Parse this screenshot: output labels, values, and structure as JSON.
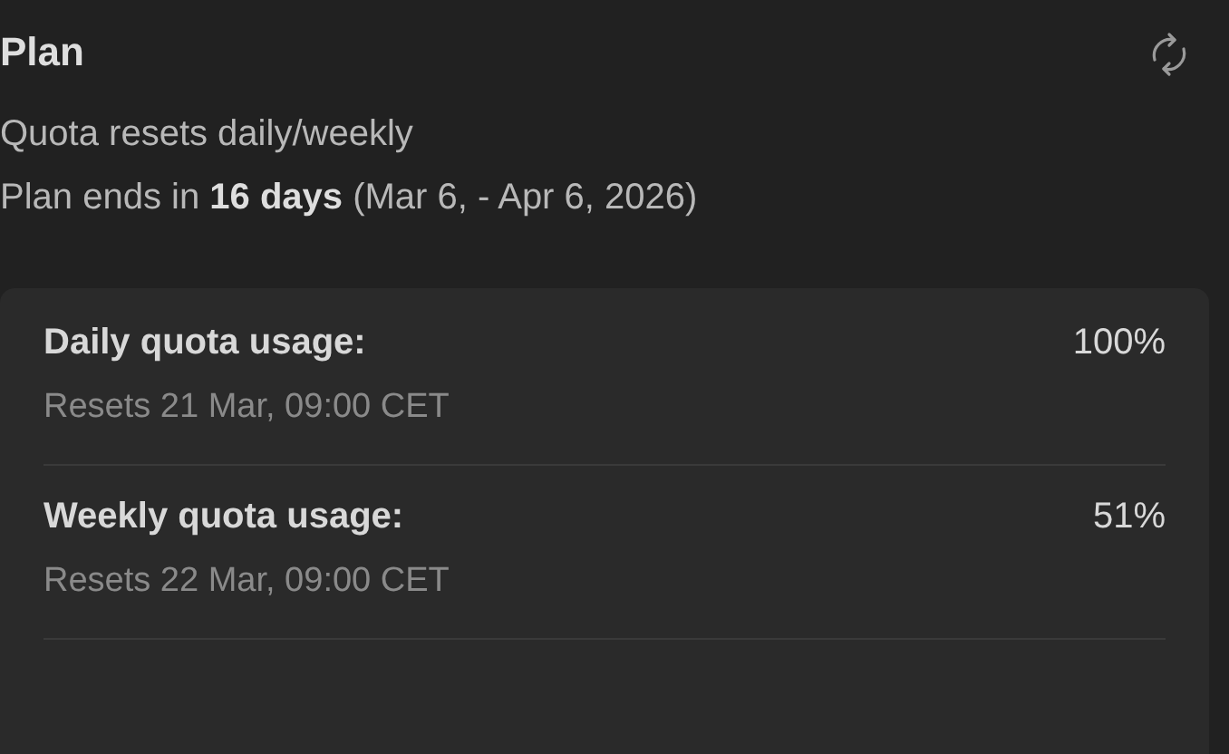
{
  "title": "Plan",
  "description": "Quota resets daily/weekly",
  "plan_end": "Plan ends in **16 days** (Mar 6, - Apr 6, 2026)",
  "quotas": [
    {
      "label": "Daily quota usage:",
      "value": "100%",
      "resets": "Resets 21 Mar, 09:00 CET"
    },
    {
      "label": "Weekly quota usage:",
      "value": "51%",
      "resets": "Resets 22 Mar, 09:00 CET"
    }
  ]
}
